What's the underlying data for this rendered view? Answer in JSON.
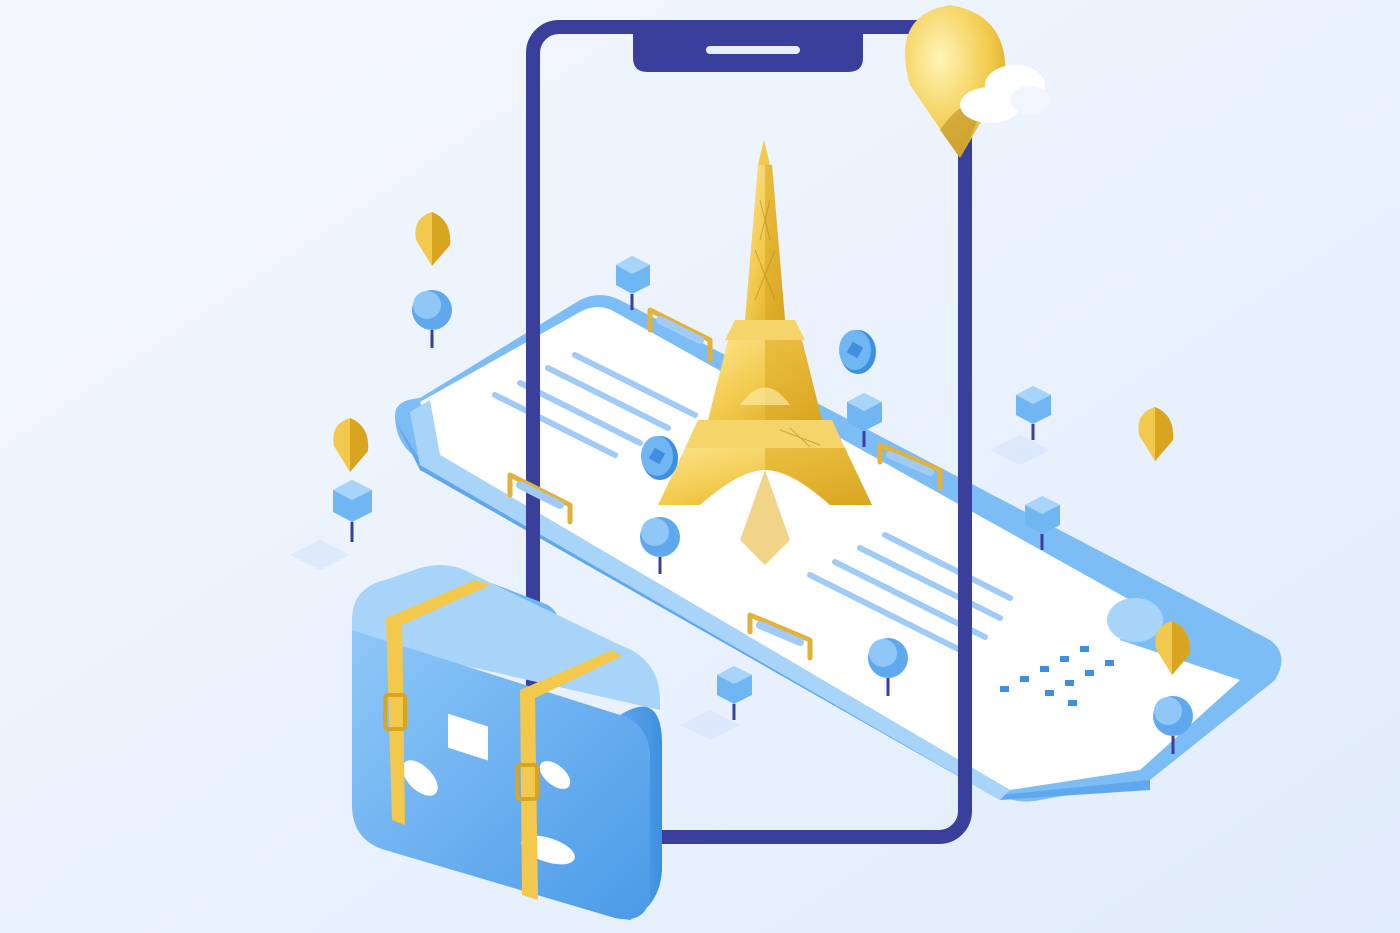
{
  "illustration": {
    "subject": "isometric-paris-travel-app",
    "icons": [
      "smartphone-frame-icon",
      "eiffel-tower-icon",
      "ticket-icon",
      "suitcase-icon",
      "location-pin-icon",
      "coin-icon",
      "tree-icon",
      "bench-icon",
      "globe-icon",
      "cloud-icon"
    ],
    "colors": {
      "background": "#EAF2FD",
      "phone_frame": "#3A3F9C",
      "gold": "#F2C94C",
      "gold_dark": "#D9A520",
      "blue": "#6FB6F2",
      "blue_dark": "#3F8FE0",
      "blue_light": "#9FD0FA",
      "ticket_white": "#FFFFFF"
    }
  }
}
